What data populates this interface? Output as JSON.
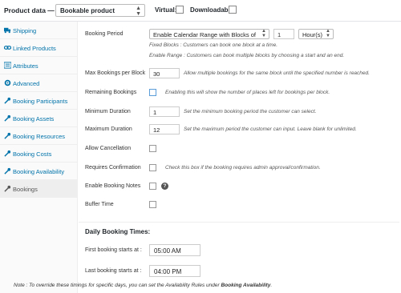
{
  "header": {
    "title": "Product data —",
    "product_type": "Bookable product",
    "virtual_label": "Virtual:",
    "downloadable_label": "Downloadable:"
  },
  "sidebar": {
    "items": [
      {
        "label": "Shipping",
        "icon": "truck-icon"
      },
      {
        "label": "Linked Products",
        "icon": "link-icon"
      },
      {
        "label": "Attributes",
        "icon": "list-icon"
      },
      {
        "label": "Advanced",
        "icon": "gear-icon"
      },
      {
        "label": "Booking Participants",
        "icon": "wrench-icon"
      },
      {
        "label": "Booking Assets",
        "icon": "wrench-icon"
      },
      {
        "label": "Booking Resources",
        "icon": "wrench-icon"
      },
      {
        "label": "Booking Costs",
        "icon": "wrench-icon"
      },
      {
        "label": "Booking Availability",
        "icon": "wrench-icon"
      },
      {
        "label": "Bookings",
        "icon": "wrench-icon",
        "active": true
      }
    ]
  },
  "form": {
    "booking_period": {
      "label": "Booking Period",
      "mode": "Enable Calendar Range with Blocks of",
      "quantity": "1",
      "unit": "Hour(s)",
      "desc_fixed": "Fixed Blocks : Customers can book one block at a time.",
      "desc_range": "Enable Range : Customers can book multiple blocks by choosing a start and an end."
    },
    "max_bookings": {
      "label": "Max Bookings per Block",
      "value": "30",
      "desc": "Allow multiple bookings for the same block until the specified number is reached."
    },
    "remaining": {
      "label": "Remaining Bookings",
      "desc": "Enabling this will show the number of places left for bookings per block."
    },
    "min_duration": {
      "label": "Minimum Duration",
      "value": "1",
      "desc": "Set the minimum booking period the customer can select."
    },
    "max_duration": {
      "label": "Maximum Duration",
      "value": "12",
      "desc": "Set the maximum period the customer can input. Leave blank for unlimited."
    },
    "allow_cancellation": {
      "label": "Allow Cancellation"
    },
    "requires_confirmation": {
      "label": "Requires Confirmation",
      "desc": "Check this box if the booking requires admin approval/confirmation."
    },
    "enable_notes": {
      "label": "Enable Booking Notes",
      "help": "?"
    },
    "buffer_time": {
      "label": "Buffer Time"
    }
  },
  "daily_times": {
    "title": "Daily Booking Times:",
    "first_label": "First booking starts at :",
    "first_value": "05:00 AM",
    "last_label": "Last booking starts at :",
    "last_value": "04:00 PM"
  },
  "note": {
    "text": "Note : To override these timings for specific days, you can set the Availability Rules under ",
    "strong": "Booking Availability",
    "end": "."
  }
}
